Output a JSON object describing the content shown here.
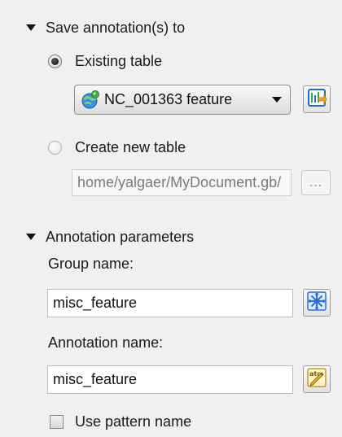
{
  "save_section": {
    "title": "Save annotation(s) to",
    "existing_table": {
      "label": "Existing table",
      "checked": true
    },
    "table_combo": {
      "value": "NC_001363 feature",
      "icon": "globe-sequence-icon"
    },
    "table_action_icon": "open-object-view-icon",
    "create_new_table": {
      "label": "Create new table",
      "checked": false
    },
    "file_path": {
      "value": "/home/yalgaer/MyDocument.gb",
      "enabled": false
    },
    "browse_label": "..."
  },
  "annotation_section": {
    "title": "Annotation parameters",
    "group_name_label": "Group name:",
    "group_name_value": "misc_feature",
    "group_action_icon": "select-group-icon",
    "annotation_name_label": "Annotation name:",
    "annotation_name_value": "misc_feature",
    "annotation_action_icon": "edit-name-icon",
    "use_pattern_name_label": "Use pattern name",
    "use_pattern_name_checked": false
  },
  "colors": {
    "panel_background": "#f0f0f0",
    "accent_blue": "#2a6fd6",
    "accent_green": "#2fa84f"
  }
}
